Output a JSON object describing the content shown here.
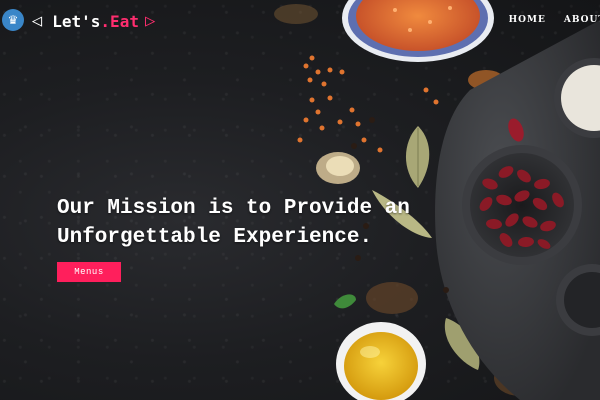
{
  "brand": {
    "icon": "chef-hat-icon",
    "left_glyph": "◁",
    "name_part1": "Let's",
    "name_part2": ".Eat",
    "right_glyph": "▷",
    "accent_color": "#ff2d6f"
  },
  "nav": {
    "items": [
      {
        "label": "HOME"
      },
      {
        "label": "ABOUT"
      }
    ]
  },
  "hero": {
    "headline_line1": "Our Mission is to Provide an",
    "headline_line2": "Unforgettable Experience.",
    "cta_label": "Menus",
    "cta_color": "#ff1f5c",
    "background_description_icons": [
      "lentil-bowl-icon",
      "muffin-tin-icon",
      "olive-oil-bowl-icon",
      "bay-leaf-icon",
      "spices-icon"
    ]
  }
}
